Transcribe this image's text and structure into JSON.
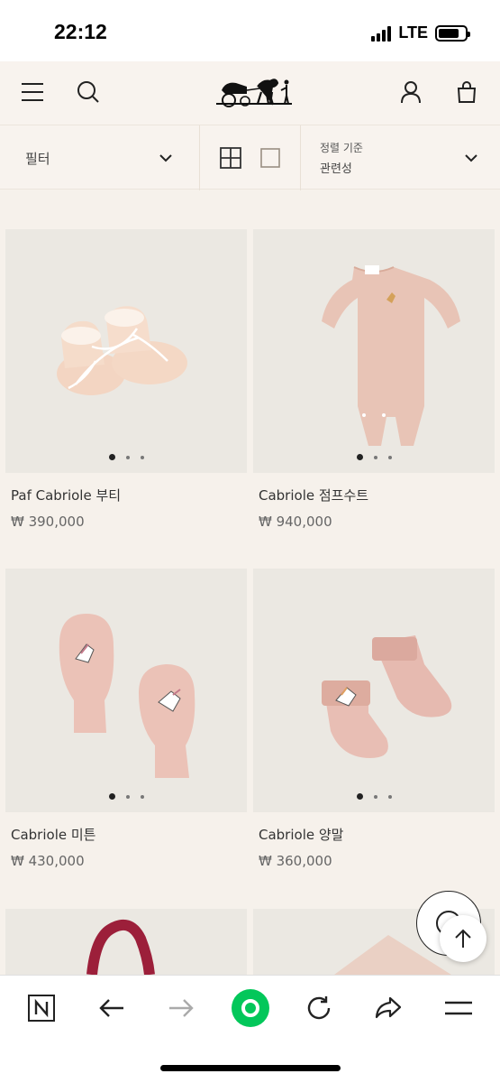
{
  "status_bar": {
    "time": "22:12",
    "network": "LTE",
    "battery_level": 0.8
  },
  "header": {
    "menu_icon": "hamburger-menu-icon",
    "search_icon": "search-icon",
    "logo_icon": "horse-carriage-logo",
    "account_icon": "user-icon",
    "cart_icon": "shopping-bag-icon"
  },
  "filter_bar": {
    "filter_label": "필터",
    "sort_caption": "정렬 기준",
    "sort_value": "관련성"
  },
  "products": [
    {
      "name": "Paf Cabriole 부티",
      "price": "₩ 390,000",
      "image_icon": "baby-booties-image",
      "slides": 3,
      "active_slide": 1
    },
    {
      "name": "Cabriole 점프수트",
      "price": "₩ 940,000",
      "image_icon": "baby-jumpsuit-image",
      "slides": 3,
      "active_slide": 1
    },
    {
      "name": "Cabriole 미튼",
      "price": "₩ 430,000",
      "image_icon": "baby-mittens-image",
      "slides": 3,
      "active_slide": 1
    },
    {
      "name": "Cabriole 양말",
      "price": "₩ 360,000",
      "image_icon": "baby-socks-image",
      "slides": 3,
      "active_slide": 1
    }
  ],
  "floating": {
    "chat_icon": "chat-icon",
    "top_icon": "arrow-up-icon"
  },
  "browser_bar": {
    "icons": [
      "naver-n-icon",
      "back-arrow-icon",
      "forward-arrow-icon",
      "green-home-icon",
      "refresh-icon",
      "share-icon",
      "menu-icon"
    ],
    "accent": "#03c75a"
  }
}
